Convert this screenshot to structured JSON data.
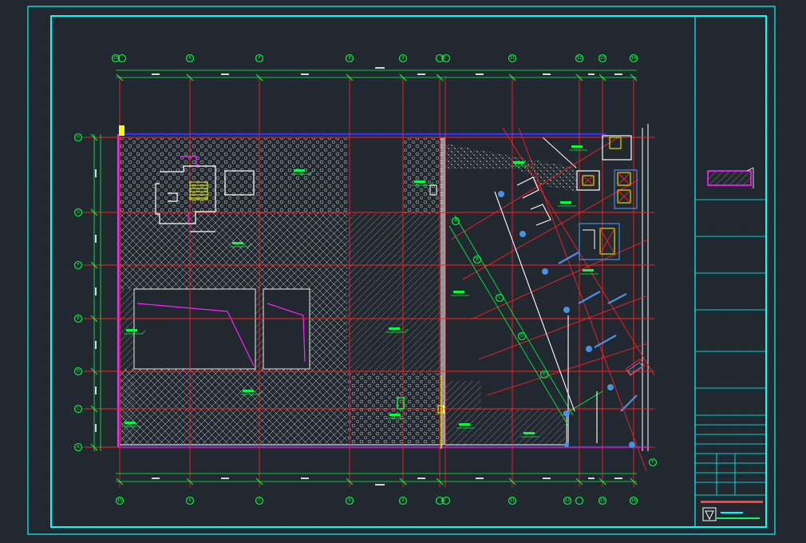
{
  "colors": {
    "background": "#212830",
    "grid_minor": "#2a323c",
    "frame": "#00ffff",
    "axis_line": "#ff2020",
    "dimension": "#00ff3c",
    "slab_edge": "#3232ff",
    "wall": "#ff22ff",
    "hatch_light": "#d9d9d9",
    "hatch_gray": "#8a8a8a",
    "structure_white": "#ffffff",
    "core_yellow": "#ffff00",
    "column_blue": "#4a90e2",
    "cut_cyan": "#00ffff"
  },
  "axes": {
    "columns_top": [
      "15",
      "6",
      "7",
      "8",
      "9",
      "10",
      "11",
      "12",
      "13",
      "14"
    ],
    "columns_bottom": [
      "15",
      "6",
      "7",
      "8",
      "9",
      "10",
      "11",
      "12",
      "13",
      "14"
    ],
    "rows_left": [
      "H",
      "G",
      "F",
      "E",
      "D",
      "C",
      "A"
    ],
    "diagonal": [
      "R",
      "B",
      "C",
      "D",
      "E",
      "F"
    ]
  },
  "icons": {
    "hatch_sample": "hatched-rectangle-swatch",
    "company_logo": "triangle-logo-icon"
  }
}
